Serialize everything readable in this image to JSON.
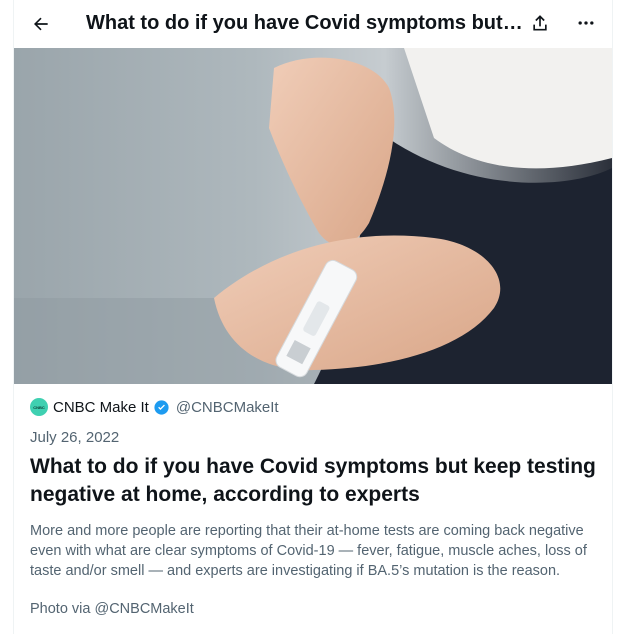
{
  "header": {
    "back_icon": "arrow-left-icon",
    "title": "What to do if you have Covid symptoms but keep testing negative at home, according to experts",
    "share_icon": "share-icon",
    "more_icon": "more-horizontal-icon"
  },
  "card": {
    "image_alt": "",
    "source": {
      "avatar_text": "CNBC",
      "name": "CNBC Make It",
      "verified": true,
      "handle": "@CNBCMakeIt"
    },
    "date": "July 26, 2022",
    "headline": "What to do if you have Covid symptoms but keep testing negative at home, according to experts",
    "description": "More and more people are reporting that their at-home tests are coming back negative even with what are clear symptoms of Covid-19 — fever, fatigue, muscle aches, loss of taste and/or smell — and experts are investigating if BA.5’s mutation is the reason.",
    "photo_credit": "Photo via @CNBCMakeIt"
  },
  "colors": {
    "text": "#0f1419",
    "secondary": "#536471",
    "verified": "#1d9bf0",
    "avatar": "#3fd0b1"
  }
}
